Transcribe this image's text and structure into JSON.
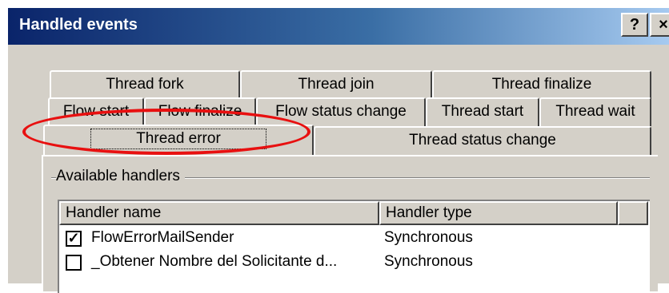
{
  "window": {
    "title": "Handled events",
    "help_label": "?",
    "close_label": "×"
  },
  "tabs": {
    "row1": [
      "Thread fork",
      "Thread join",
      "Thread finalize"
    ],
    "row2": [
      "Flow start",
      "Flow finalize",
      "Flow status change",
      "Thread start",
      "Thread wait"
    ],
    "row3": [
      "Thread error",
      "Thread status change"
    ],
    "active": "Thread error"
  },
  "handlers": {
    "group_label": "Available handlers",
    "columns": [
      "Handler name",
      "Handler type"
    ],
    "rows": [
      {
        "checked": true,
        "check_mark": "✓",
        "name": "FlowErrorMailSender",
        "type": "Synchronous"
      },
      {
        "checked": false,
        "check_mark": "",
        "name": "_Obtener Nombre del Solicitante d...",
        "type": "Synchronous"
      }
    ]
  },
  "annotation": {
    "shape": "ellipse",
    "color": "#e81010"
  }
}
